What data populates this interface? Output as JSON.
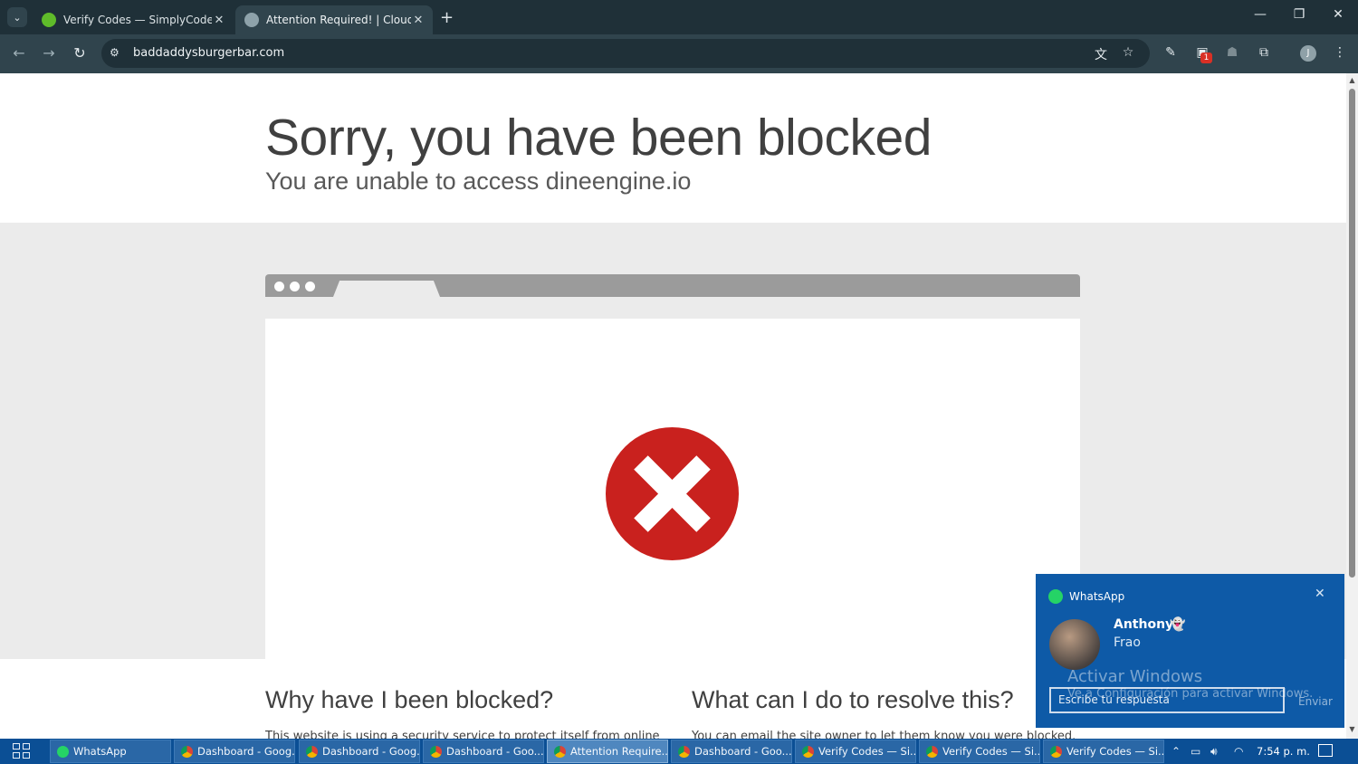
{
  "browser": {
    "tabs": [
      {
        "title": "Verify Codes — SimplyCodes",
        "active": false
      },
      {
        "title": "Attention Required! | Cloudflare",
        "active": true
      }
    ],
    "new_tab": "+",
    "window_controls": {
      "minimize": "—",
      "restore": "❐",
      "close": "✕"
    },
    "tab_close": "✕",
    "url": "baddaddysburgerbar.com",
    "profile_initial": "J",
    "extension_badge": "1"
  },
  "page": {
    "title": "Sorry, you have been blocked",
    "subtitle": "You are unable to access dineengine.io",
    "why_heading": "Why have I been blocked?",
    "resolve_heading": "What can I do to resolve this?",
    "why_text": "This website is using a security service to protect itself from online",
    "resolve_text": "You can email the site owner to let them know you were blocked."
  },
  "toast": {
    "app": "WhatsApp",
    "sender": "Anthony",
    "sender_emoji": "👻",
    "message": "Frao",
    "reply_placeholder": "Escribe tu respuesta",
    "send": "Enviar",
    "watermark_title": "Activar Windows",
    "watermark_sub": "Ve a Configuración para activar Windows."
  },
  "taskbar": {
    "items": [
      {
        "label": "WhatsApp",
        "icon": "whatsapp-icon",
        "active": false
      },
      {
        "label": "Dashboard - Goog...",
        "icon": "chrome-icon",
        "active": false
      },
      {
        "label": "Dashboard - Goog...",
        "icon": "chrome-icon",
        "active": false
      },
      {
        "label": "Dashboard - Goo...",
        "icon": "chrome-icon",
        "active": false
      },
      {
        "label": "Attention Require...",
        "icon": "chrome-icon",
        "active": true
      },
      {
        "label": "Dashboard - Goo...",
        "icon": "chrome-icon",
        "active": false
      },
      {
        "label": "Verify Codes — Si...",
        "icon": "chrome-icon",
        "active": false
      },
      {
        "label": "Verify Codes — Si...",
        "icon": "chrome-icon",
        "active": false
      },
      {
        "label": "Verify Codes — Si...",
        "icon": "chrome-icon",
        "active": false
      }
    ],
    "clock": "7:54 p. m."
  },
  "colors": {
    "error_red": "#c9211e",
    "toast_blue": "#0e5aa7",
    "taskbar_blue": "#0b4f95",
    "chrome_dark": "#1f3038"
  }
}
